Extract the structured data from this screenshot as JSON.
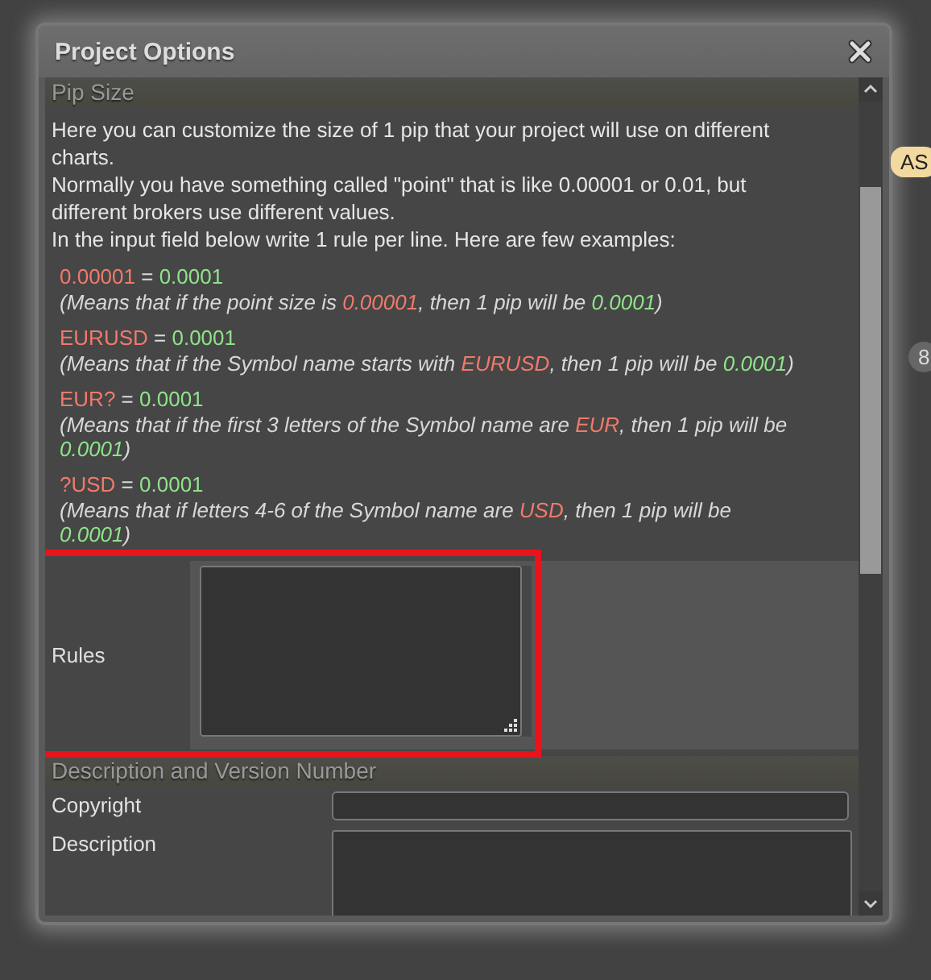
{
  "background_badges": [
    {
      "text": "AS"
    },
    {
      "text": "8"
    }
  ],
  "dialog": {
    "title": "Project Options",
    "sections": [
      {
        "title": "Pip Size",
        "intro": [
          "Here you can customize the size of 1 pip that your project will use on different charts.",
          "Normally you have something called \"point\" that is like 0.00001 or 0.01, but different brokers use different values.",
          "In the input field below write 1 rule per line. Here are few examples:"
        ],
        "examples": [
          {
            "rule": [
              {
                "kind": "key",
                "text": "0.00001"
              },
              {
                "kind": "plain",
                "text": " = "
              },
              {
                "kind": "value",
                "text": "0.0001"
              }
            ],
            "note": [
              {
                "kind": "plain",
                "text": "(Means that if the point size is "
              },
              {
                "kind": "key",
                "text": "0.00001"
              },
              {
                "kind": "plain",
                "text": ", then 1 pip will be "
              },
              {
                "kind": "value",
                "text": "0.0001"
              },
              {
                "kind": "plain",
                "text": ")"
              }
            ]
          },
          {
            "rule": [
              {
                "kind": "key",
                "text": "EURUSD"
              },
              {
                "kind": "plain",
                "text": " = "
              },
              {
                "kind": "value",
                "text": "0.0001"
              }
            ],
            "note": [
              {
                "kind": "plain",
                "text": "(Means that if the Symbol name starts with "
              },
              {
                "kind": "key",
                "text": "EURUSD"
              },
              {
                "kind": "plain",
                "text": ", then 1 pip will be "
              },
              {
                "kind": "value",
                "text": "0.0001"
              },
              {
                "kind": "plain",
                "text": ")"
              }
            ]
          },
          {
            "rule": [
              {
                "kind": "key",
                "text": "EUR?"
              },
              {
                "kind": "plain",
                "text": " = "
              },
              {
                "kind": "value",
                "text": "0.0001"
              }
            ],
            "note": [
              {
                "kind": "plain",
                "text": "(Means that if the first 3 letters of the Symbol name are "
              },
              {
                "kind": "key",
                "text": "EUR"
              },
              {
                "kind": "plain",
                "text": ", then 1 pip will be "
              },
              {
                "kind": "value",
                "text": "0.0001"
              },
              {
                "kind": "plain",
                "text": ")"
              }
            ]
          },
          {
            "rule": [
              {
                "kind": "key",
                "text": "?USD"
              },
              {
                "kind": "plain",
                "text": " = "
              },
              {
                "kind": "value",
                "text": "0.0001"
              }
            ],
            "note": [
              {
                "kind": "plain",
                "text": "(Means that if letters 4-6 of the Symbol name are "
              },
              {
                "kind": "key",
                "text": "USD"
              },
              {
                "kind": "plain",
                "text": ", then 1 pip will be "
              },
              {
                "kind": "value",
                "text": "0.0001"
              },
              {
                "kind": "plain",
                "text": ")"
              }
            ]
          }
        ],
        "fields": [
          {
            "label": "Rules",
            "kind": "textarea"
          }
        ]
      },
      {
        "title": "Description and Version Number",
        "fields": [
          {
            "label": "Copyright",
            "kind": "input"
          },
          {
            "label": "Description",
            "kind": "textarea"
          }
        ]
      }
    ]
  }
}
